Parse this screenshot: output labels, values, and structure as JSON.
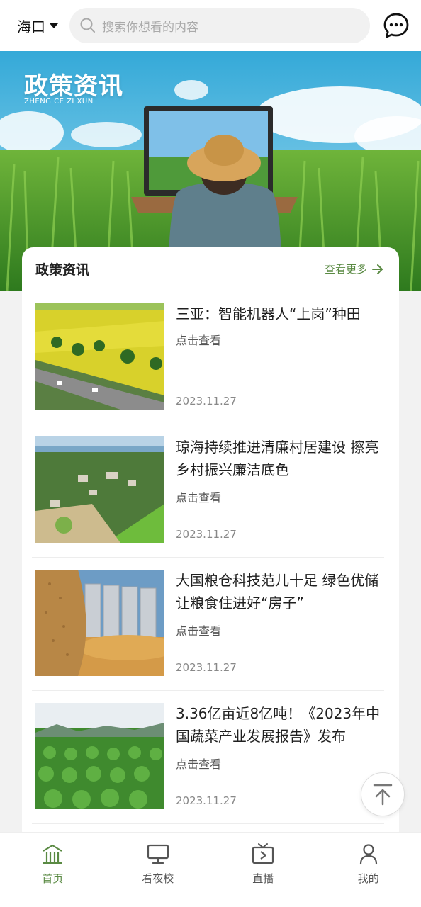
{
  "header": {
    "city": "海口",
    "search_placeholder": "搜索你想看的内容"
  },
  "banner": {
    "title": "政策资讯",
    "subtitle": "ZHENG CE ZI XUN"
  },
  "section": {
    "title": "政策资讯",
    "more_label": "查看更多"
  },
  "articles": [
    {
      "title": "三亚：智能机器人“上岗”种田",
      "link_label": "点击查看",
      "date": "2023.11.27"
    },
    {
      "title": "琼海持续推进清廉村居建设 擦亮乡村振兴廉洁底色",
      "link_label": "点击查看",
      "date": "2023.11.27"
    },
    {
      "title": "大国粮仓科技范儿十足 绿色优储让粮食住进好“房子”",
      "link_label": "点击查看",
      "date": "2023.11.27"
    },
    {
      "title": "3.36亿亩近8亿吨！《2023年中国蔬菜产业发展报告》发布",
      "link_label": "点击查看",
      "date": "2023.11.27"
    }
  ],
  "tabbar": {
    "items": [
      {
        "label": "首页",
        "icon": "home-icon",
        "active": true
      },
      {
        "label": "看夜校",
        "icon": "monitor-icon",
        "active": false
      },
      {
        "label": "直播",
        "icon": "tv-play-icon",
        "active": false
      },
      {
        "label": "我的",
        "icon": "user-icon",
        "active": false
      }
    ]
  },
  "colors": {
    "accent": "#5a8a43",
    "page_bg": "#f2f2f2"
  }
}
